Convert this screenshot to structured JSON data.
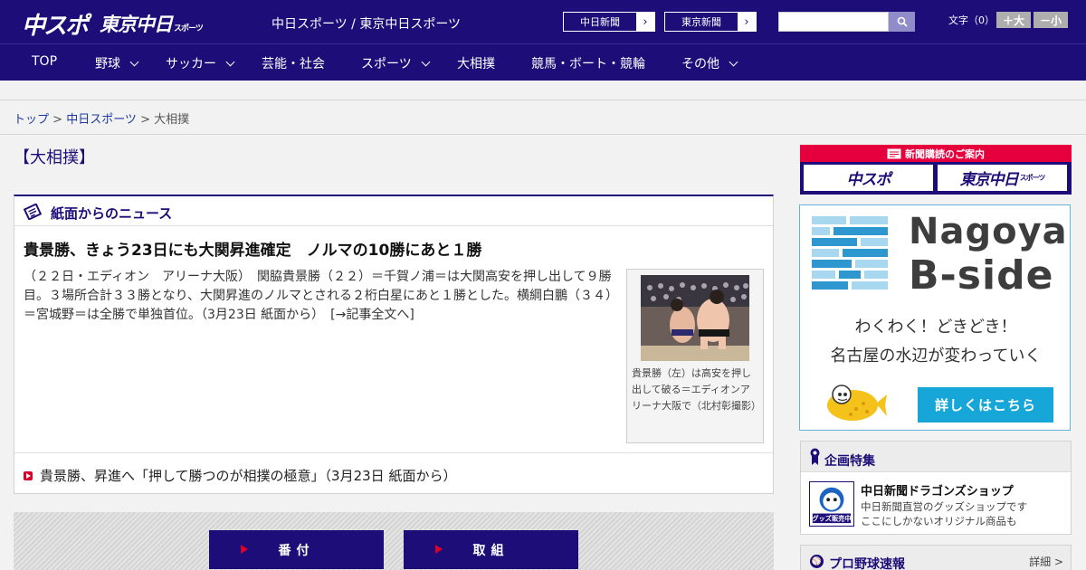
{
  "header": {
    "logo_main": "中スポ",
    "logo_tokyo": "東京中日",
    "logo_tokyo_small": "スポーツ",
    "site_name": "中日スポーツ / 東京中日スポーツ",
    "link_chunichi": "中日新聞",
    "link_tokyo": "東京新聞",
    "search_placeholder": "",
    "font_label": "文字（0）",
    "font_larger": "＋大",
    "font_smaller": "－小"
  },
  "nav": {
    "items": [
      {
        "label": "TOP"
      },
      {
        "label": "野球"
      },
      {
        "label": "サッカー"
      },
      {
        "label": "芸能・社会"
      },
      {
        "label": "スポーツ"
      },
      {
        "label": "大相撲"
      },
      {
        "label": "競馬・ボート・競輪"
      },
      {
        "label": "その他"
      }
    ]
  },
  "breadcrumb": {
    "home": "トップ",
    "sep": " > ",
    "section": "中日スポーツ",
    "current": "大相撲"
  },
  "page_title": "【大相撲】",
  "news": {
    "section_label": "紙面からのニュース",
    "headline": "貴景勝、きょう23日にも大関昇進確定　ノルマの10勝にあと１勝",
    "summary": "（２２日・エディオン　アリーナ大阪）　関脇貴景勝（２２）＝千賀ノ浦＝は大関高安を押し出して９勝目。３場所合計３３勝となり、大関昇進のノルマとされる２桁白星にあと１勝とした。横綱白鵬（３４）＝宮城野＝は全勝で単独首位。（3月23日 紙面から）　[→記事全文へ]",
    "photo_caption": "貴景勝（左）は高安を押し出して破る＝エディオンアリーナ大阪で（北村彰撮影）",
    "related": "貴景勝、昇進へ「押して勝つのが相撲の極意」（3月23日 紙面から）"
  },
  "sumo_buttons": {
    "banzuke": "番付",
    "torikumi": "取組"
  },
  "sidebar": {
    "subscribe_head": "新聞購読のご案内",
    "sub_logo_1": "中スポ",
    "sub_logo_2": "東京中日",
    "sub_logo_2_small": "スポーツ",
    "ad_title_1": "Nagoya",
    "ad_title_2": "B-side",
    "ad_line_1": "わくわく！どきどき！",
    "ad_line_2": "名古屋の水辺が変わっていく",
    "ad_cta": "詳しくはこちら",
    "feature_head": "企画特集",
    "feature_name": "中日新聞ドラゴンズショップ",
    "feature_desc_1": "中日新聞直営のグッズショップです",
    "feature_desc_2": "ここにしかないオリジナル商品も",
    "feature_thumb_text": "グッズ販売中",
    "baseball_head": "プロ野球速報",
    "baseball_detail": "詳細 >"
  },
  "colors": {
    "brand_navy": "#1c0d78",
    "accent_red": "#e5003d",
    "ad_blue": "#17a6d8"
  }
}
